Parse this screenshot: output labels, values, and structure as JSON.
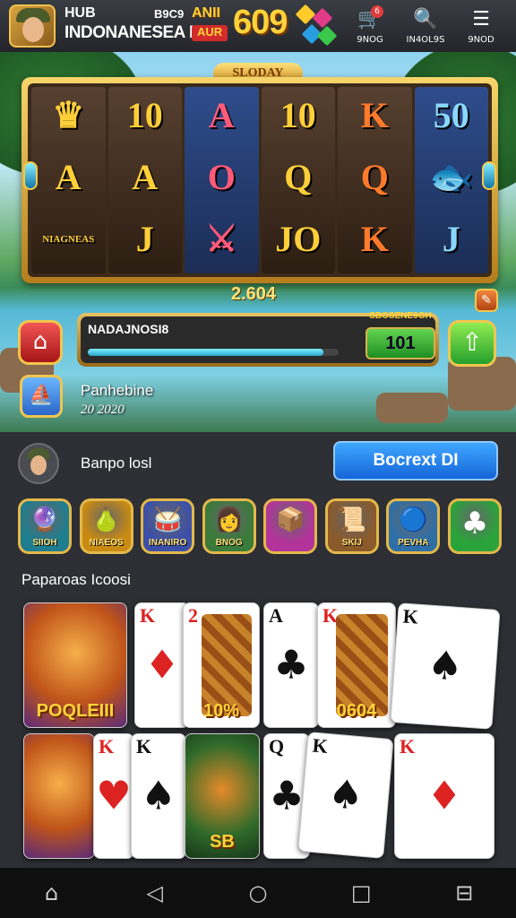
{
  "header": {
    "brand_line1": "HUB",
    "brand_line2": "INDONANESEA I",
    "mini_label1": "B9C9",
    "mini_label2": "ANII",
    "mini_label3": "AUR",
    "score": "609",
    "nav": [
      {
        "label": "9NOG",
        "icon": "cart-icon",
        "glyph": "🛒",
        "badge": "6"
      },
      {
        "label": "IN4OL9S",
        "icon": "search-icon",
        "glyph": "🔍"
      },
      {
        "label": "9NOD",
        "icon": "menu-icon",
        "glyph": "☰"
      }
    ]
  },
  "slot": {
    "title": "SLODAY",
    "reels": [
      [
        "♛",
        "A",
        "NIAGNEAS"
      ],
      [
        "10",
        "A",
        "J"
      ],
      [
        "A",
        "O",
        "⚔"
      ],
      [
        "10",
        "Q",
        "JO"
      ],
      [
        "K",
        "Q",
        "K"
      ],
      [
        "50",
        "🐟",
        "J"
      ]
    ],
    "win_amount": "2.604"
  },
  "spin_bar": {
    "title": "NADAJNOSI8",
    "progress": 0.94,
    "bet_label": "SBOSENE9GH",
    "bet_value": "101"
  },
  "promo": {
    "line1": "Panhebine",
    "line2": "20 2020"
  },
  "profile": {
    "name": "Banpo losl",
    "cta_label": "Bocrext DI"
  },
  "games": [
    {
      "label": "SIIOH",
      "icon": "globe-icon",
      "glyph": "🔮",
      "bg": "#1e7d8f"
    },
    {
      "label": "NIAEOS",
      "icon": "pear-icon",
      "glyph": "🍐",
      "bg": "#c88a12"
    },
    {
      "label": "INANIRO",
      "icon": "drum-icon",
      "glyph": "🥁",
      "bg": "#3b4fa8"
    },
    {
      "label": "BNOG",
      "icon": "avatar-icon",
      "glyph": "👩",
      "bg": "#3a7a3a"
    },
    {
      "label": "",
      "icon": "chest-icon",
      "glyph": "📦",
      "bg": "#b2349a"
    },
    {
      "label": "SKIJ",
      "icon": "scroll-icon",
      "glyph": "📜",
      "bg": "#8a5a2a"
    },
    {
      "label": "PEVHA",
      "icon": "orb-icon",
      "glyph": "🔵",
      "bg": "#2f6fa8"
    },
    {
      "label": "",
      "icon": "club-icon",
      "glyph": "♣",
      "bg": "#2aa33a"
    }
  ],
  "section_title": "Paparoas Icoosi",
  "cards_row1": [
    {
      "rank": "",
      "caption": "POQLEIII",
      "art": "lion"
    },
    {
      "rank": "K",
      "suit": "♦",
      "color": "#d22"
    },
    {
      "rank": "2",
      "suit": "♦",
      "color": "#d22",
      "caption": "10%"
    },
    {
      "rank": "A",
      "suit": "♣",
      "color": "#111"
    },
    {
      "rank": "K",
      "suit": "♦",
      "color": "#d22",
      "caption": "0604"
    },
    {
      "rank": "K",
      "suit": "♠",
      "color": "#111"
    }
  ],
  "cards_row2": [
    {
      "rank": "",
      "art": "lion"
    },
    {
      "rank": "K",
      "suit": "♥",
      "color": "#d22"
    },
    {
      "rank": "K",
      "suit": "♠",
      "color": "#111"
    },
    {
      "rank": "",
      "caption": "SB",
      "art": "fish"
    },
    {
      "rank": "Q",
      "suit": "♣",
      "color": "#111"
    },
    {
      "rank": "K",
      "suit": "♠",
      "color": "#111"
    },
    {
      "rank": "K",
      "suit": "♦",
      "color": "#d22"
    }
  ],
  "colors": {
    "gold": "#f1c64e",
    "panel": "#2d2f34",
    "cta": "#1565d8"
  }
}
